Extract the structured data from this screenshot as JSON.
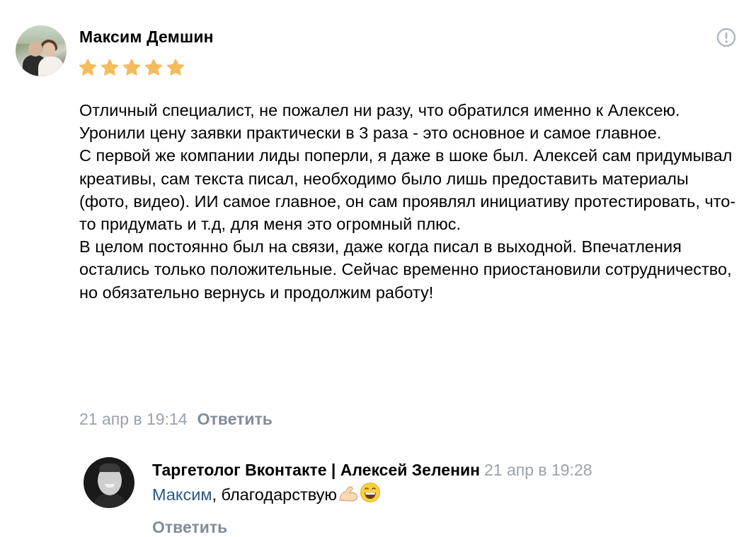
{
  "review": {
    "author": "Максим Демшин",
    "rating": 5,
    "max_rating": 5,
    "star_color": "#f5bb5c",
    "paragraphs": [
      "Отличный специалист, не пожалел ни разу, что обратился именно к Алексею.",
      "Уронили цену заявки практически в 3 раза - это основное и самое главное.",
      "С первой же компании лиды поперли, я даже в шоке был. Алексей сам придумывал креативы, сам текста писал, необходимо было лишь предоставить материалы (фото, видео). ИИ самое главное, он сам проявлял инициативу протестировать, что-то придумать и т.д, для меня это огромный плюс.",
      "В целом постоянно был на связи, даже когда писал в выходной. Впечатления остались только положительные. Сейчас временно приостановили сотрудничество, но обязательно вернусь и продолжим работу!"
    ],
    "date": "21 апр в 19:14",
    "reply_label": "Ответить",
    "report_icon": "exclamation-circle-icon"
  },
  "reply": {
    "author": "Таргетолог Вконтакте | Алексей Зеленин",
    "date": "21 апр в 19:28",
    "mention": "Максим",
    "text": ", благодарствую",
    "emojis": [
      "flexed-biceps-icon",
      "grinning-face-icon"
    ],
    "reply_label": "Ответить"
  },
  "colors": {
    "meta_gray": "#99a2ad",
    "link_gray": "#818c99",
    "mention_blue": "#2a5885"
  }
}
